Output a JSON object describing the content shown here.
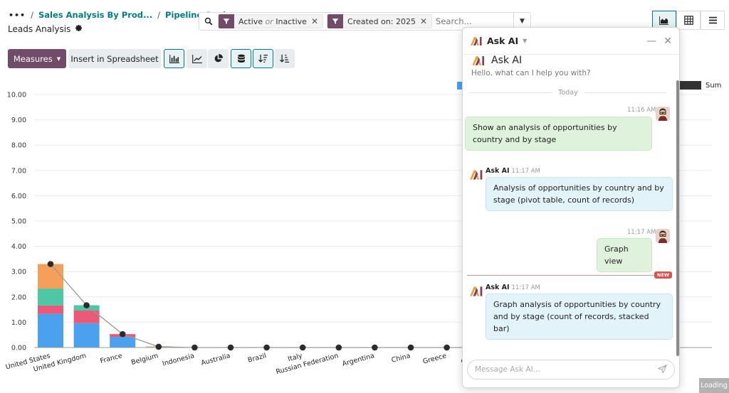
{
  "breadcrumb": {
    "dots": "•••",
    "items": [
      "Sales Analysis By Prod...",
      "Pipeline Anal..."
    ]
  },
  "page": {
    "title": "Leads Analysis"
  },
  "search": {
    "facets": [
      {
        "prefix": "Active",
        "or": "or",
        "suffix": "Inactive"
      },
      {
        "label": "Created on: 2025"
      }
    ],
    "placeholder": "Search..."
  },
  "toolbar": {
    "measures_label": "Measures",
    "insert_label": "Insert in Spreadsheet"
  },
  "colors": {
    "brand": "#714b67",
    "accent": "#017e84",
    "stage_blue": "#4aa2ee",
    "stage_red": "#ea5a78",
    "stage_teal": "#4fc6a4",
    "stage_orange": "#f5a05a"
  },
  "chart_data": {
    "type": "bar",
    "stacked": true,
    "categories": [
      "United States",
      "United Kingdom",
      "France",
      "Belgium",
      "Indonesia",
      "Australia",
      "Brazil",
      "Italy",
      "Russian Federation",
      "Argentina",
      "China",
      "Greece",
      "Venezuela"
    ],
    "series": [
      {
        "color": "#4aa2ee",
        "values": [
          1.33,
          0.96,
          0.42,
          0,
          0,
          0,
          0,
          0,
          0,
          0,
          0,
          0,
          0
        ]
      },
      {
        "color": "#ea5a78",
        "values": [
          0.33,
          0.5,
          0.11,
          0,
          0,
          0,
          0,
          0,
          0,
          0,
          0,
          0,
          0
        ]
      },
      {
        "color": "#4fc6a4",
        "values": [
          0.67,
          0.21,
          0,
          0,
          0,
          0,
          0,
          0,
          0,
          0,
          0,
          0,
          0
        ]
      },
      {
        "color": "#f5a05a",
        "values": [
          0.97,
          0,
          0,
          0,
          0,
          0,
          0,
          0,
          0,
          0,
          0,
          0,
          0
        ]
      },
      {
        "color": "#e8c2a0",
        "values": [
          0,
          0,
          0,
          0.05,
          0,
          0,
          0,
          0,
          0,
          0,
          0,
          0,
          0
        ]
      }
    ],
    "cumulative": {
      "name": "Sum",
      "values": [
        3.3,
        1.67,
        0.53,
        0.03,
        0,
        0,
        0,
        0,
        0,
        0,
        0,
        0,
        0
      ]
    },
    "yticks": [
      "0.00",
      "1.00",
      "2.00",
      "3.00",
      "4.00",
      "5.00",
      "6.00",
      "7.00",
      "8.00",
      "9.00",
      "10.00"
    ],
    "ylim": [
      0,
      10
    ],
    "grid": true,
    "legend": "top-right",
    "xlabel_partial_last": "ezuela"
  },
  "ai_panel": {
    "title": "Ask AI",
    "intro_name": "Ask AI",
    "intro_text": "Hello, what can I help you with?",
    "divider": "Today",
    "new_badge": "NEW",
    "composer_placeholder": "Message Ask AI...",
    "messages": [
      {
        "role": "user",
        "time": "11:16 AM",
        "text": "Show an analysis of opportunities by country and by stage"
      },
      {
        "role": "bot",
        "name": "Ask AI",
        "time": "11:17 AM",
        "text": "Analysis of opportunities by country and by stage (pivot table, count of records)"
      },
      {
        "role": "user",
        "time": "11:17 AM",
        "text": "Graph view"
      },
      {
        "role": "bot",
        "name": "Ask AI",
        "time": "11:17 AM",
        "text": "Graph analysis of opportunities by country and by stage (count of records, stacked bar)"
      }
    ]
  },
  "status": {
    "loading": "Loading"
  }
}
